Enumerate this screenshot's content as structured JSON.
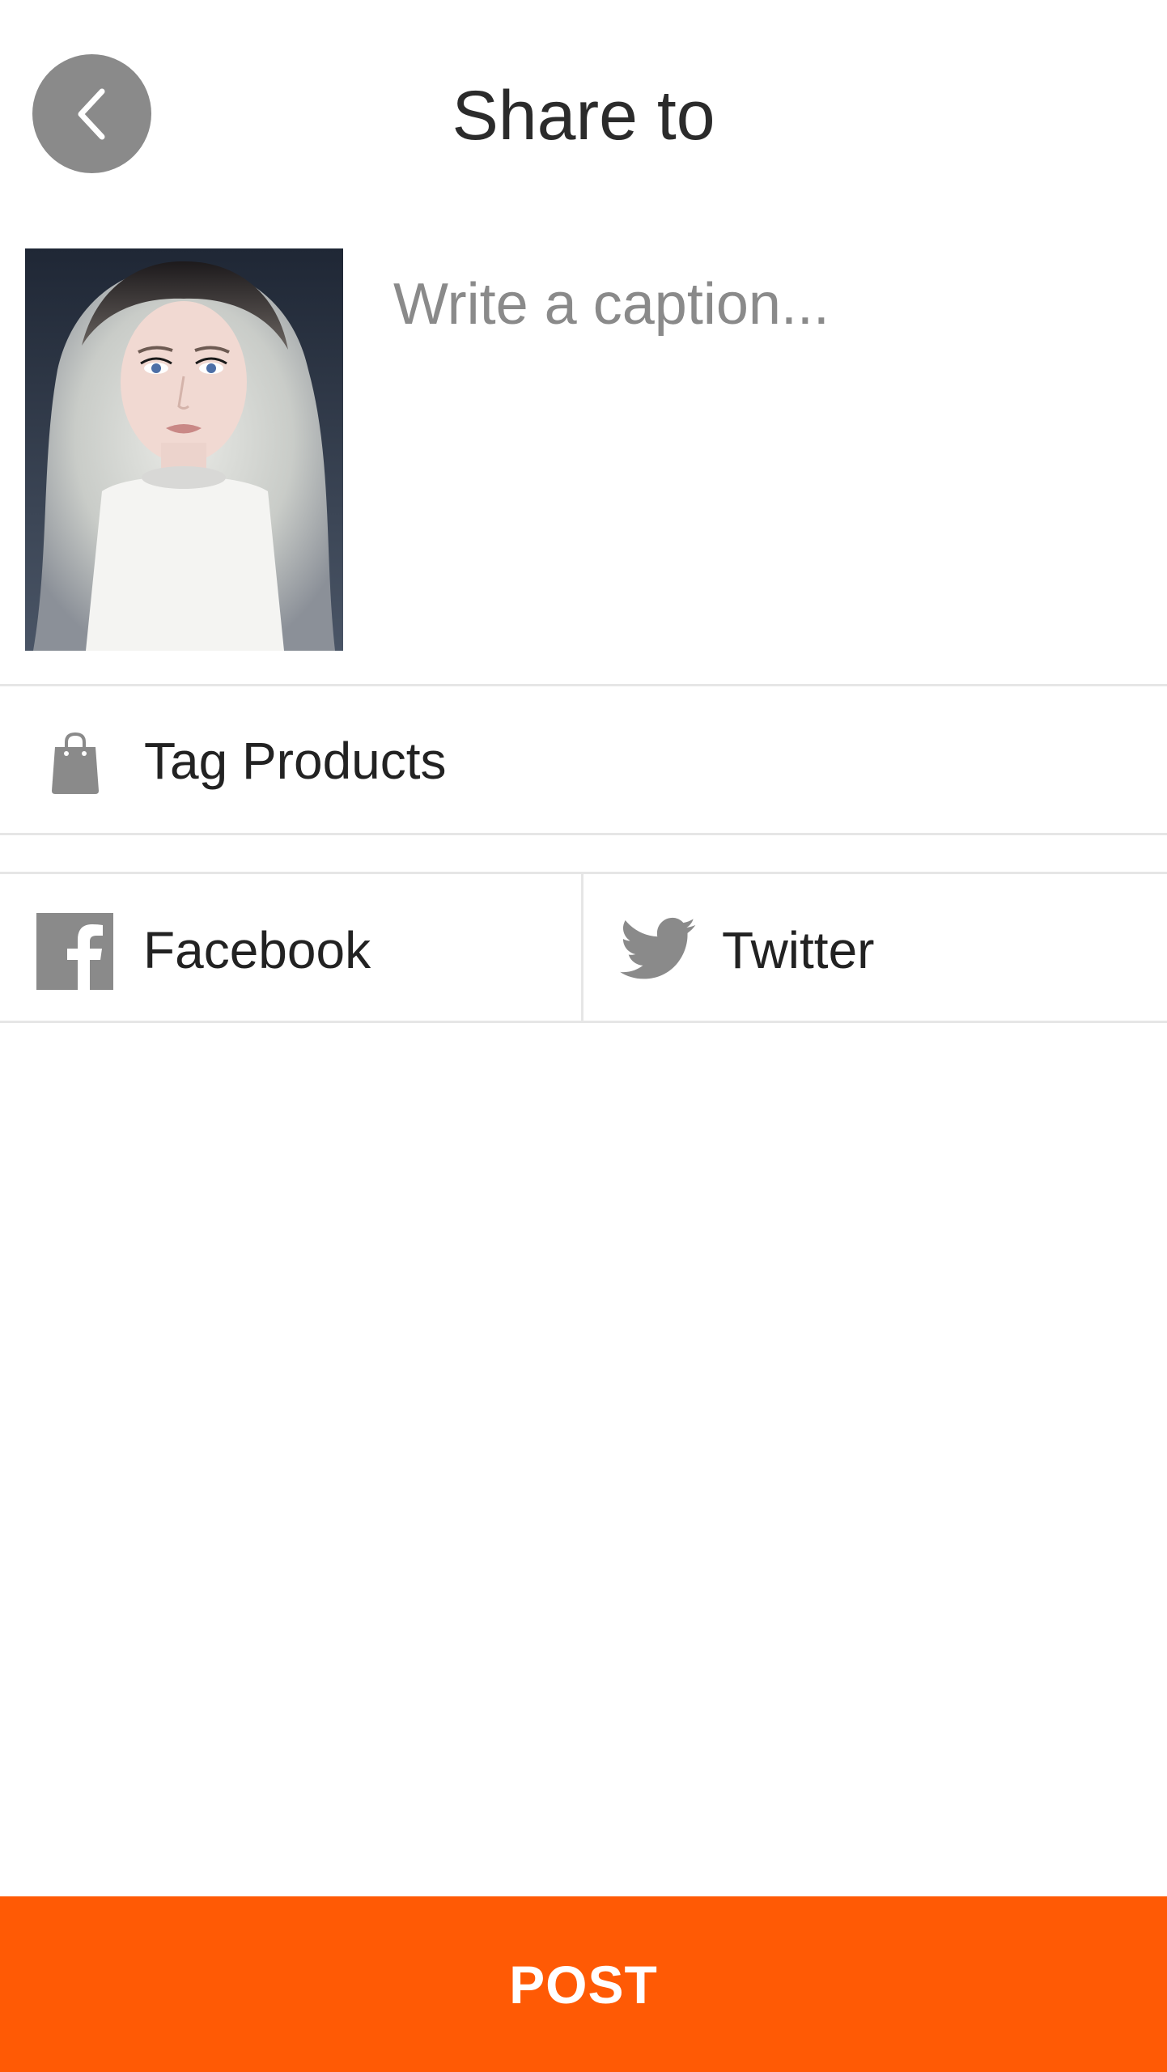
{
  "header": {
    "title": "Share to",
    "back_icon": "chevron-left-icon"
  },
  "composer": {
    "caption_placeholder": "Write a caption...",
    "caption_value": "",
    "thumbnail_alt": "photo-thumbnail"
  },
  "tag_products": {
    "label": "Tag Products",
    "icon": "shopping-bag-icon"
  },
  "share": {
    "options": [
      {
        "label": "Facebook",
        "icon": "facebook-icon"
      },
      {
        "label": "Twitter",
        "icon": "twitter-icon"
      }
    ]
  },
  "post_button": {
    "label": "POST"
  },
  "colors": {
    "accent": "#ff5a05",
    "icon_gray": "#8a8a8a",
    "divider": "#e6e6e6",
    "text": "#222222"
  }
}
